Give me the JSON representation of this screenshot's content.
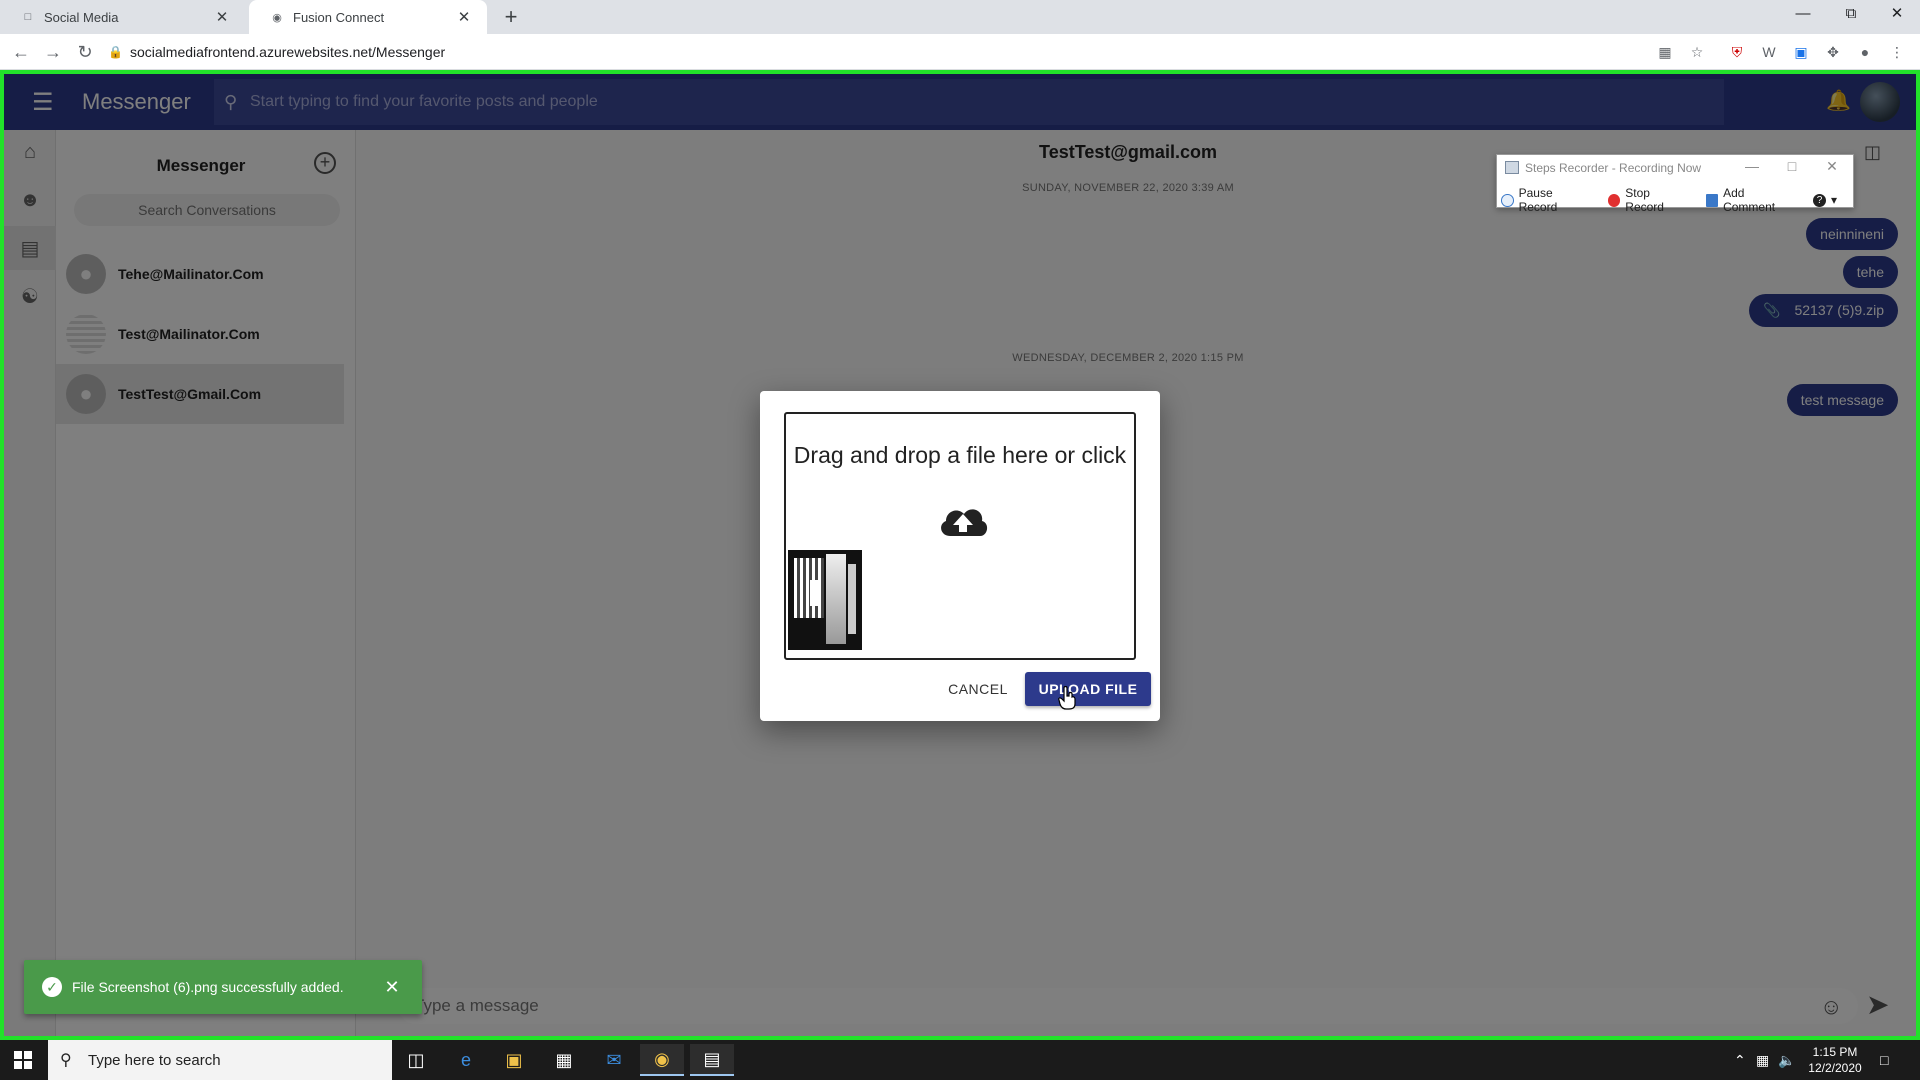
{
  "browser": {
    "tabs": [
      {
        "title": "Social Media",
        "active": false
      },
      {
        "title": "Fusion Connect",
        "active": true
      }
    ],
    "new_tab": "+",
    "url": "socialmediafrontend.azurewebsites.net/Messenger"
  },
  "app": {
    "title": "Messenger",
    "search_placeholder": "Start typing to find your favorite posts and people"
  },
  "conversations": {
    "header": "Messenger",
    "search_placeholder": "Search Conversations",
    "items": [
      {
        "name": "Tehe@Mailinator.Com"
      },
      {
        "name": "Test@Mailinator.Com"
      },
      {
        "name": "TestTest@Gmail.Com",
        "selected": true
      }
    ]
  },
  "chat": {
    "title": "TestTest@gmail.com",
    "date_1": "SUNDAY, NOVEMBER 22, 2020 3:39 AM",
    "date_2": "WEDNESDAY, DECEMBER 2, 2020 1:15 PM",
    "messages": [
      {
        "text": "neinnineni"
      },
      {
        "text": "tehe"
      },
      {
        "text": "52137 (5)9.zip",
        "attachment": true
      },
      {
        "text": "test message"
      }
    ],
    "composer_placeholder": "Type a message"
  },
  "dialog": {
    "dropzone_text": "Drag and drop a file here or click",
    "cancel_label": "CANCEL",
    "upload_label": "UPLOAD FILE"
  },
  "steps_recorder": {
    "title": "Steps Recorder - Recording Now",
    "pause": "Pause Record",
    "stop": "Stop Record",
    "comment": "Add Comment"
  },
  "snackbar": {
    "message": "File Screenshot (6).png successfully added."
  },
  "taskbar": {
    "search_placeholder": "Type here to search",
    "time": "1:15 PM",
    "date": "12/2/2020"
  },
  "colors": {
    "brand": "#2d3a8c",
    "recording_border": "#22e22a",
    "success": "#4a9a4a"
  }
}
